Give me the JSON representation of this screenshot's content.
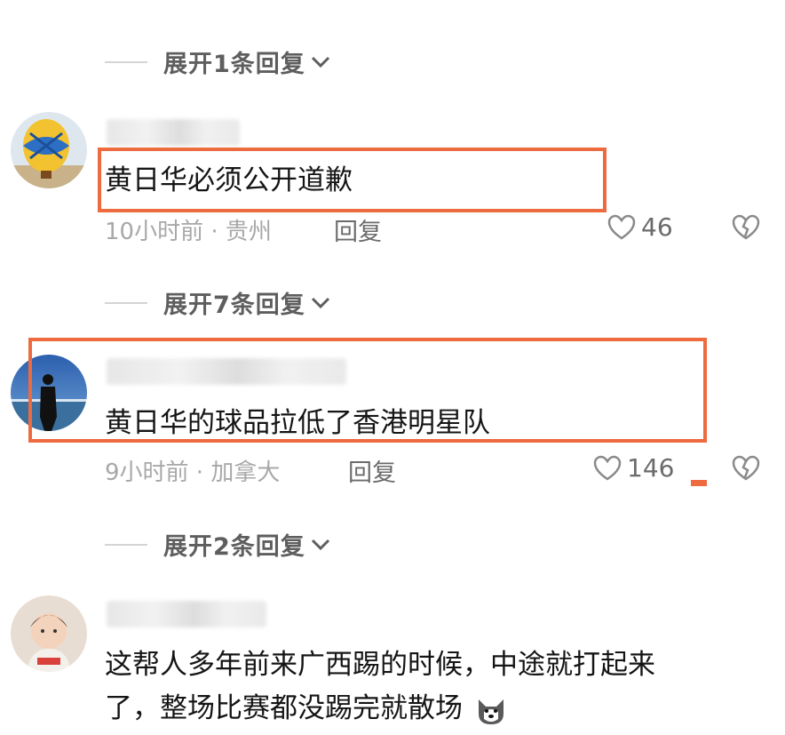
{
  "threads": [
    {
      "expand_label": "展开1条回复"
    },
    {
      "comment_text": "黄日华必须公开道歉",
      "meta": "10小时前 · 贵州",
      "reply_label": "回复",
      "likes": "46",
      "expand_label": "展开7条回复"
    },
    {
      "comment_text": "黄日华的球品拉低了香港明星队",
      "meta": "9小时前 · 加拿大",
      "reply_label": "回复",
      "likes": "146",
      "expand_label": "展开2条回复"
    },
    {
      "comment_line1": "这帮人多年前来广西踢的时候，中途就打起来",
      "comment_line2": "了，整场比赛都没踢完就散场"
    }
  ],
  "colors": {
    "highlight": "#ed6b3f",
    "meta": "#a8a8a8",
    "text": "#151515"
  }
}
